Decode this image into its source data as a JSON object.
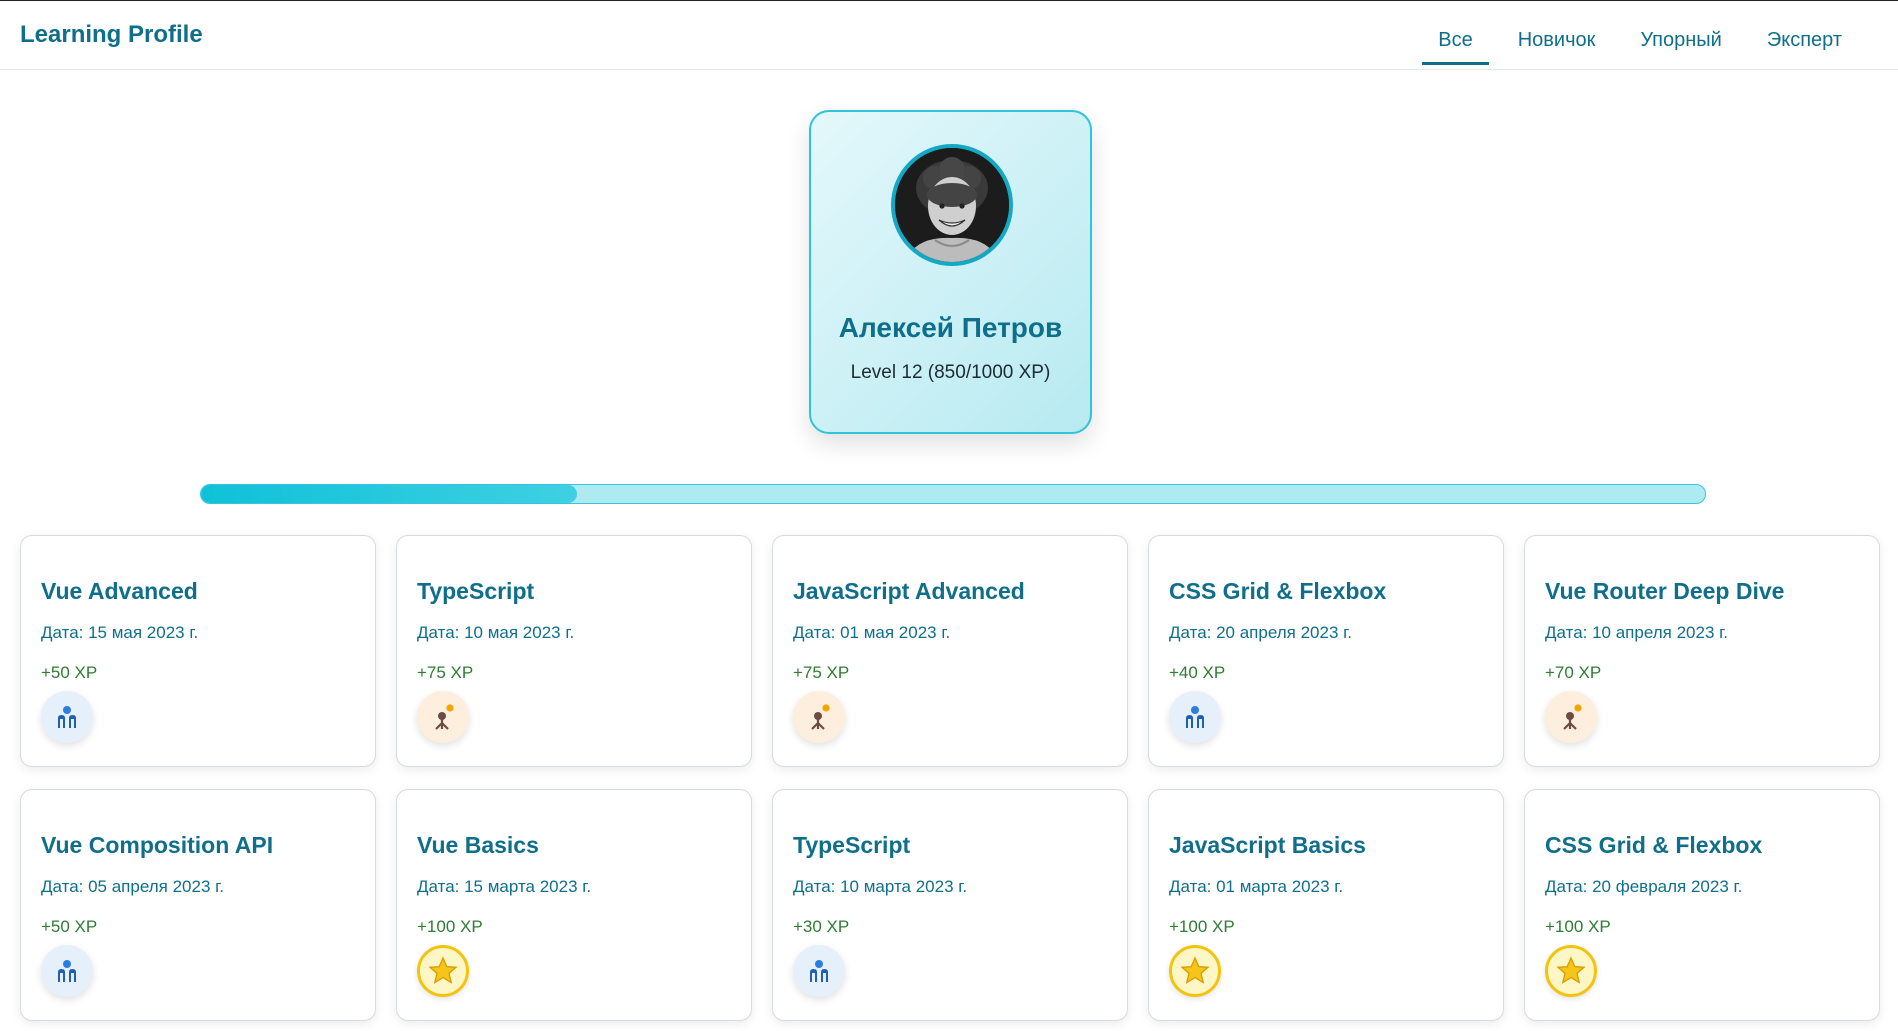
{
  "header": {
    "title": "Learning Profile",
    "tabs": [
      {
        "label": "Все",
        "active": true
      },
      {
        "label": "Новичок",
        "active": false
      },
      {
        "label": "Упорный",
        "active": false
      },
      {
        "label": "Эксперт",
        "active": false
      }
    ]
  },
  "profile": {
    "name": "Алексей Петров",
    "level_text": "Level 12 (850/1000 XP)",
    "progress_fraction": 0.25
  },
  "courses": [
    {
      "title": "Vue Advanced",
      "date": "Дата: 15 мая 2023 г.",
      "xp": "+50 XP",
      "badge": "people"
    },
    {
      "title": "TypeScript",
      "date": "Дата: 10 мая 2023 г.",
      "xp": "+75 XP",
      "badge": "tree"
    },
    {
      "title": "JavaScript Advanced",
      "date": "Дата: 01 мая 2023 г.",
      "xp": "+75 XP",
      "badge": "tree"
    },
    {
      "title": "CSS Grid & Flexbox",
      "date": "Дата: 20 апреля 2023 г.",
      "xp": "+40 XP",
      "badge": "people"
    },
    {
      "title": "Vue Router Deep Dive",
      "date": "Дата: 10 апреля 2023 г.",
      "xp": "+70 XP",
      "badge": "tree"
    },
    {
      "title": "Vue Composition API",
      "date": "Дата: 05 апреля 2023 г.",
      "xp": "+50 XP",
      "badge": "people"
    },
    {
      "title": "Vue Basics",
      "date": "Дата: 15 марта 2023 г.",
      "xp": "+100 XP",
      "badge": "star"
    },
    {
      "title": "TypeScript",
      "date": "Дата: 10 марта 2023 г.",
      "xp": "+30 XP",
      "badge": "people"
    },
    {
      "title": "JavaScript Basics",
      "date": "Дата: 01 марта 2023 г.",
      "xp": "+100 XP",
      "badge": "star"
    },
    {
      "title": "CSS Grid & Flexbox",
      "date": "Дата: 20 февраля 2023 г.",
      "xp": "+100 XP",
      "badge": "star"
    }
  ],
  "colors": {
    "accent": "#0f6f8a",
    "progress": "#0fc1d8",
    "xp_green": "#2e7d32"
  }
}
